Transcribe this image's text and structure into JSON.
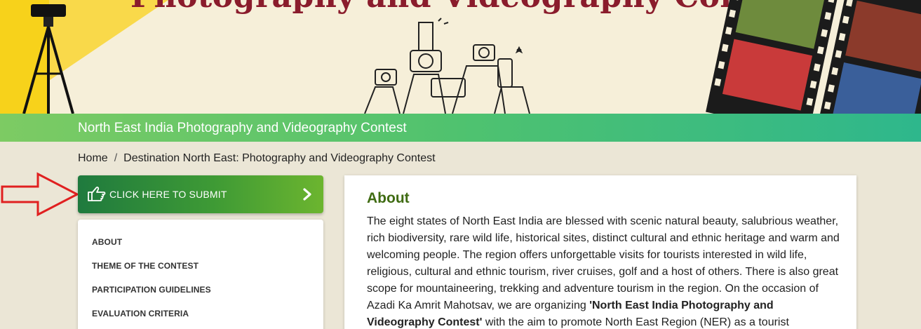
{
  "banner": {
    "title": "Photography and Videography Contest"
  },
  "greenbar": {
    "title": "North East India Photography and Videography Contest"
  },
  "breadcrumb": {
    "home": "Home",
    "separator": "/",
    "current": "Destination North East: Photography and Videography Contest"
  },
  "submit": {
    "label": "CLICK HERE TO SUBMIT",
    "icon": "pointing-hand-icon",
    "chevron_icon": "chevron-right-icon"
  },
  "sidebar": {
    "items": [
      {
        "label": "ABOUT"
      },
      {
        "label": "THEME OF THE CONTEST"
      },
      {
        "label": "PARTICIPATION GUIDELINES"
      },
      {
        "label": "EVALUATION CRITERIA"
      }
    ]
  },
  "about": {
    "heading": "About",
    "text_intro": "The eight states of North East India are blessed with scenic natural beauty, salubrious weather, rich biodiversity, rare wild life, historical sites, distinct cultural and ethnic heritage and warm and welcoming people. The region offers unforgettable visits for tourists interested in wild life, religious, cultural and ethnic tourism, river cruises, golf and a host of others. There is also great scope for mountaineering, trekking and adventure tourism in the region. On the occasion of Azadi Ka Amrit Mahotsav, we are organizing ",
    "text_bold": "'North East India Photography and Videography Contest'",
    "text_tail": " with the aim to promote North East Region (NER) as a tourist"
  },
  "colors": {
    "accent_green": "#3e9a35",
    "heading_green": "#3f6b12",
    "banner_title_red": "#8a1c2c",
    "arrow_red": "#e02020"
  }
}
